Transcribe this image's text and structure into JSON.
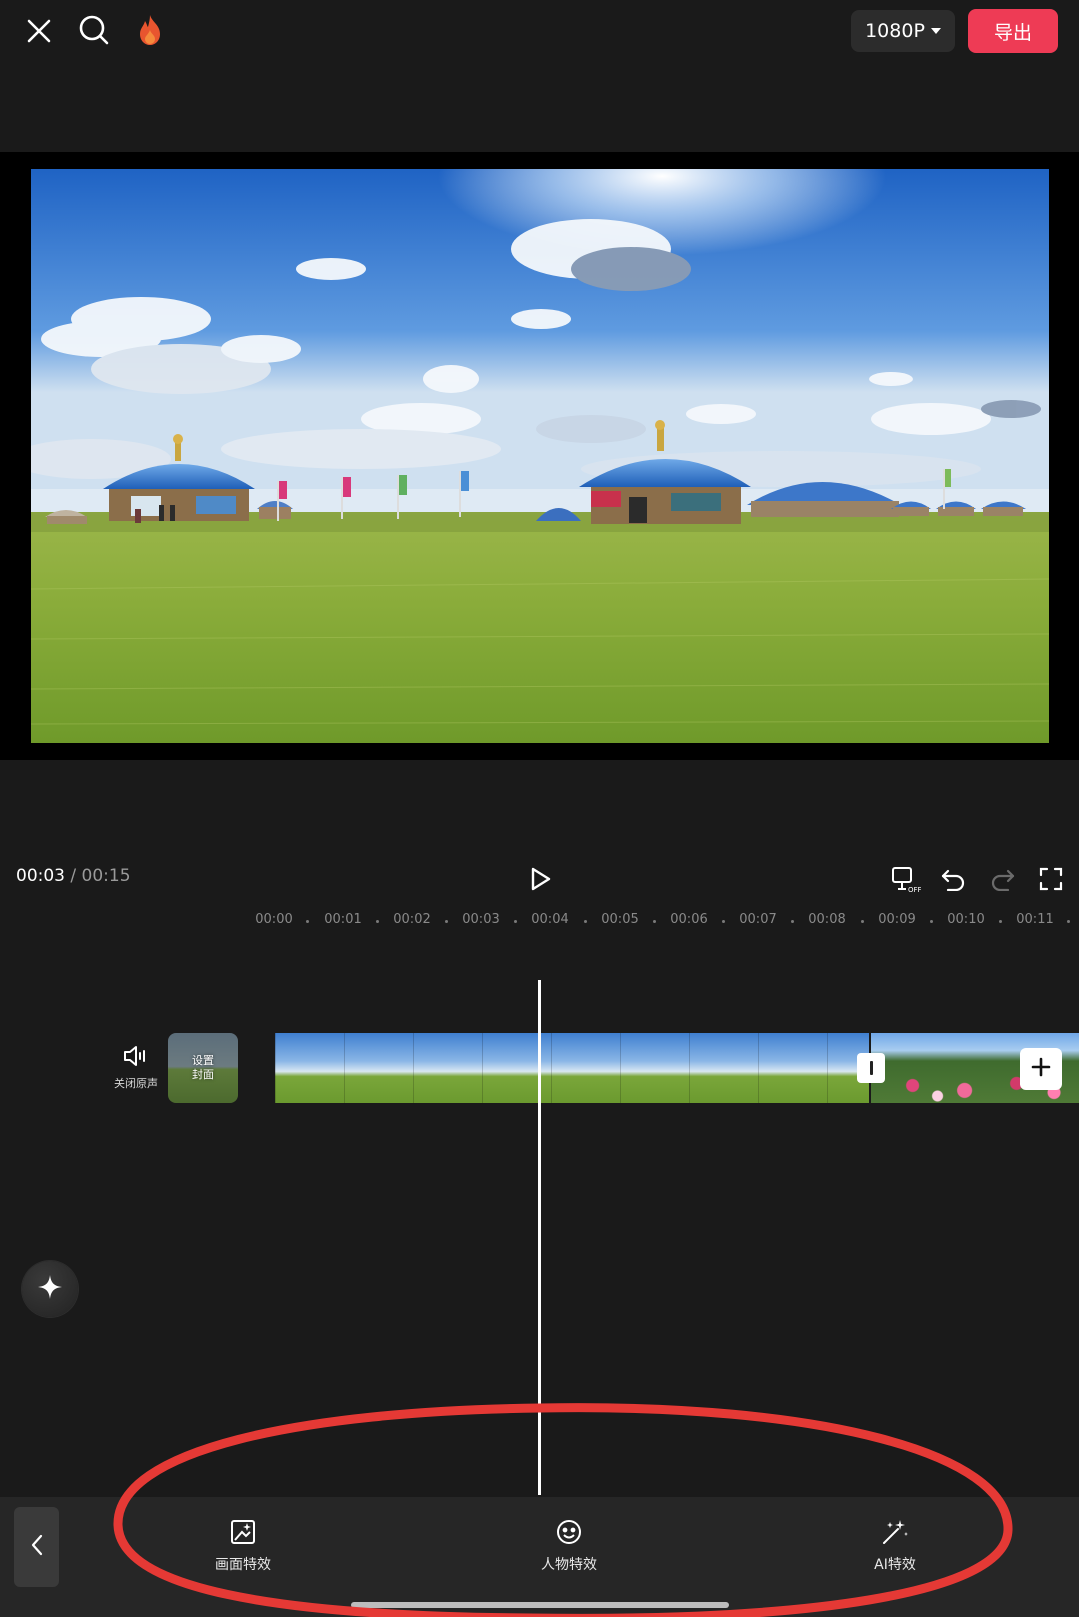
{
  "topbar": {
    "resolution_label": "1080P",
    "export_label": "导出",
    "icons": [
      "close-icon",
      "search-icon",
      "flame-icon"
    ]
  },
  "playback": {
    "current_time": "00:03",
    "separator": "/",
    "total_time": "00:15",
    "icons": [
      "play-icon",
      "keyframe-off-icon",
      "undo-icon",
      "redo-icon",
      "fullscreen-icon"
    ]
  },
  "ruler": {
    "labels": [
      "00:00",
      "00:01",
      "00:02",
      "00:03",
      "00:04",
      "00:05",
      "00:06",
      "00:07",
      "00:08",
      "00:09",
      "00:10",
      "00:11"
    ]
  },
  "track": {
    "mute_label": "关闭原声",
    "cover_label": "设置\n封面"
  },
  "toolbar": {
    "items": [
      {
        "label": "画面特效",
        "icon": "image-effect-icon"
      },
      {
        "label": "人物特效",
        "icon": "face-effect-icon"
      },
      {
        "label": "AI特效",
        "icon": "magic-wand-icon"
      }
    ]
  },
  "colors": {
    "accent": "#ee3b55",
    "annotation": "#e53935",
    "background": "#1a1a1a"
  }
}
